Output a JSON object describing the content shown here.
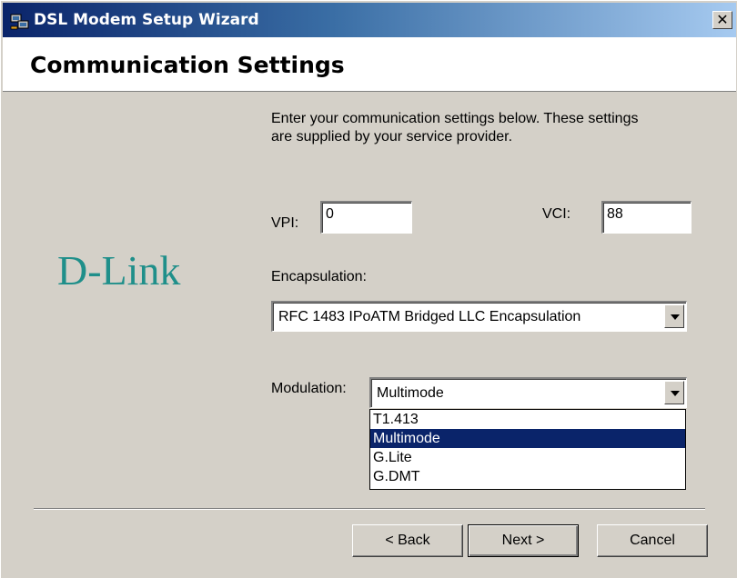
{
  "window": {
    "title": "DSL Modem Setup Wizard",
    "close_glyph": "✕"
  },
  "header": {
    "title": "Communication Settings"
  },
  "logo": {
    "text": "D-Link",
    "color": "#1f8f8a"
  },
  "instructions": "Enter your communication settings below.  These settings are supplied by your service provider.",
  "vpi": {
    "label": "VPI:",
    "value": "0"
  },
  "vci": {
    "label": "VCI:",
    "value": "88"
  },
  "encapsulation": {
    "label": "Encapsulation:",
    "selected": "RFC 1483 IPoATM Bridged LLC Encapsulation"
  },
  "modulation": {
    "label": "Modulation:",
    "selected": "Multimode",
    "options": [
      "T1.413",
      "Multimode",
      "G.Lite",
      "G.DMT"
    ],
    "highlighted_index": 1
  },
  "buttons": {
    "back": "< Back",
    "next": "Next >",
    "cancel": "Cancel"
  },
  "colors": {
    "title_gradient_start": "#0a246a",
    "title_gradient_end": "#a6caf0",
    "selection": "#0a246a",
    "face": "#d4d0c8"
  }
}
